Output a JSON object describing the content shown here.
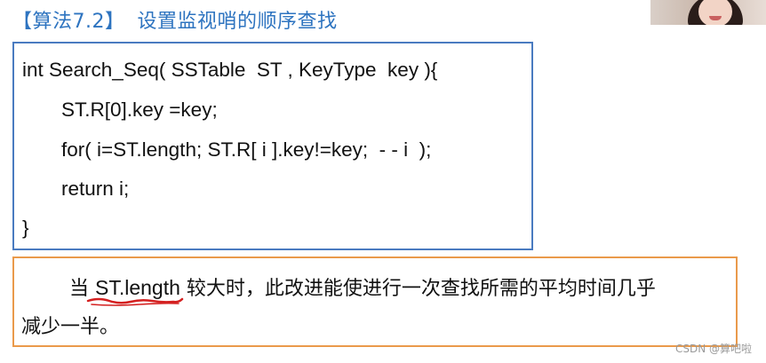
{
  "slide": {
    "title_tag": "【算法7.2】",
    "title_text": "设置监视哨的顺序查找",
    "code_lines": [
      "int Search_Seq( SSTable  ST , KeyType  key ){",
      "ST.R[0].key =key;",
      "for( i=ST.length; ST.R[ i ].key!=key;  - - i  );",
      "return i;",
      "}"
    ],
    "note": {
      "prefix": "当 ",
      "emphasis": "ST.length",
      "line1_rest": " 较大时，此改进能使进行一次查找所需的平均时间几乎",
      "line2": "减少一半。"
    }
  },
  "watermark": "CSDN @算吧啦",
  "colors": {
    "title": "#2e74c0",
    "code_border": "#4a7bc0",
    "note_border": "#ea9a4b",
    "underline_annotation": "#d42020"
  },
  "icons": {
    "webcam": "presenter-webcam-feed"
  }
}
